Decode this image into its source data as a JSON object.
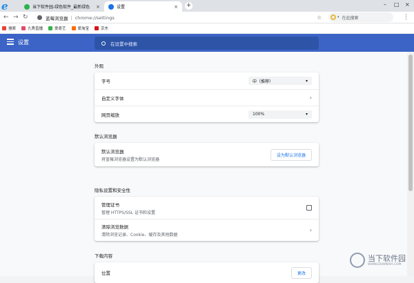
{
  "browser": {
    "logo": "e",
    "tabs": [
      {
        "title": "当下软件园-绿色软件_最新绿色",
        "close": "×"
      },
      {
        "title": "设置",
        "close": "×"
      }
    ],
    "new_tab": "+",
    "window_controls": {
      "minimize": "–",
      "maximize": "□",
      "close": "×"
    },
    "nav": {
      "back": "←",
      "forward": "→",
      "reload": "↻"
    },
    "address": {
      "site_name": "蓝莓浏览器",
      "separator": "|",
      "url": "chrome://settings"
    },
    "star": "☆",
    "search_placeholder": "在此搜索",
    "menu": "⋮",
    "bookmarks": [
      {
        "label": "搜索",
        "color": "#e94235"
      },
      {
        "label": "九秀直播",
        "color": "#e04b6c"
      },
      {
        "label": "爱奇艺",
        "color": "#35b34a"
      },
      {
        "label": "爱淘宝",
        "color": "#ff6a00"
      },
      {
        "label": "京东",
        "color": "#d7141a"
      }
    ]
  },
  "settings": {
    "title": "设置",
    "search_placeholder": "在设置中搜索",
    "appearance": {
      "heading": "外观",
      "font_size_label": "字号",
      "font_size_value": "中（推荐）",
      "custom_fonts_label": "自定义字体",
      "zoom_label": "网页缩放",
      "zoom_value": "100%"
    },
    "default_browser": {
      "heading": "默认浏览器",
      "title": "默认浏览器",
      "subtitle": "将蓝莓浏览器设置为默认浏览器",
      "button": "设为默认浏览器"
    },
    "privacy": {
      "heading": "隐私设置和安全性",
      "cert_title": "管理证书",
      "cert_subtitle": "管理 HTTPS/SSL 证书和设置",
      "clear_title": "清除浏览数据",
      "clear_subtitle": "清除浏览记录、Cookie、缓存及其他数据"
    },
    "downloads": {
      "heading": "下载内容",
      "location_label": "位置",
      "change_button": "更改"
    }
  },
  "watermark": {
    "line1": "当下软件园",
    "line2": "WWW.DOWNXIA.COM"
  },
  "colors": {
    "header": "#3c64c6",
    "accent": "#1a73e8"
  }
}
